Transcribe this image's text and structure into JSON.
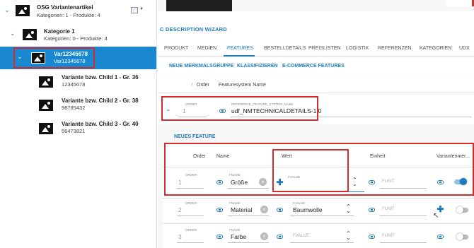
{
  "tree": {
    "root": {
      "title": "OSG Variantenartikel",
      "subtitle": "Kategorien: 1 - Produkte: 4"
    },
    "category": {
      "title": "Kategorie 1",
      "subtitle": "Kategorien: 0 - Produkte: 4"
    },
    "selected": {
      "title": "Var12345678",
      "subtitle": "Var12345678"
    },
    "children": [
      {
        "title": "Variante bzw. Child 1 - Gr. 36",
        "subtitle": "12345678"
      },
      {
        "title": "Variante bzw. Child 2 - Gr. 38",
        "subtitle": "98765432"
      },
      {
        "title": "Variante bzw. Child 3 - Gr. 40",
        "subtitle": "56473821"
      }
    ]
  },
  "wizard": {
    "title": "C DESCRIPTION WIZARD"
  },
  "tabs": [
    "PRODUKT",
    "MEDIEN",
    "FEATURES",
    "BESTELLDETAILS",
    "PREISLISTEN",
    "LOGISTIK",
    "REFERENZEN",
    "KATEGORIEN",
    "UDX"
  ],
  "active_tab": "FEATURES",
  "actions": [
    "NEUE MERKMALSGRUPPE",
    "KLASSIFIZIEREN",
    "E-COMMERCE FEATURES"
  ],
  "group_table": {
    "col_order": "Order",
    "col_name": "Featuresystem Name",
    "row": {
      "order_label": "ORDER",
      "order": "1",
      "name_label": "REFERENCE_FEATURE_SYSTEM_NAME",
      "name": "udf_NMTECHNICALDETAILS-1.0"
    }
  },
  "new_feature": "NEUES FEATURE",
  "feature_table": {
    "headers": {
      "order": "Order",
      "name": "Name",
      "wert": "Wert",
      "einheit": "Einheit",
      "variant": "Variantenmer..."
    },
    "rows": [
      {
        "order_label": "ORDER",
        "order": "1",
        "name_label": "FNAME",
        "name": "Größe",
        "wert_label": "FVALUE",
        "wert": "",
        "unit": "FUNIT",
        "variant_on": true
      },
      {
        "order_label": "ORDER",
        "order": "2",
        "name_label": "FNAME",
        "name": "Material",
        "wert_label": "FVALUE",
        "wert": "Baumwolle",
        "unit": "FUNIT",
        "variant_on": false
      },
      {
        "order_label": "ORDER",
        "order": "3",
        "name_label": "FNAME",
        "name": "Farbe",
        "wert_label": "",
        "wert": "FVALUE",
        "unit": "FUNIT",
        "variant_on": false
      }
    ]
  },
  "colors": {
    "accent": "#1b7bbf",
    "selected_bg": "#1a88d0",
    "highlight": "#d72b2b"
  }
}
